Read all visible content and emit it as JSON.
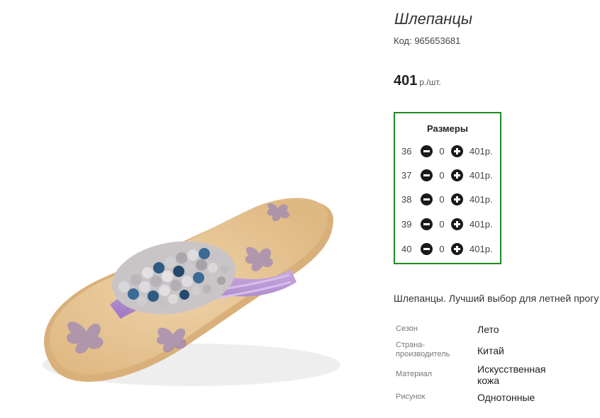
{
  "product": {
    "title": "Шлепанцы",
    "code": "Код: 965653681",
    "price": "401",
    "price_unit": "р./шт."
  },
  "sizes": {
    "heading": "Размеры",
    "rows": [
      {
        "size": "36",
        "qty": "0",
        "price": "401р."
      },
      {
        "size": "37",
        "qty": "0",
        "price": "401р."
      },
      {
        "size": "38",
        "qty": "0",
        "price": "401р."
      },
      {
        "size": "39",
        "qty": "0",
        "price": "401р."
      },
      {
        "size": "40",
        "qty": "0",
        "price": "401р."
      }
    ]
  },
  "description": "Шлепанцы. Лучший выбор для летней прогу",
  "properties": [
    {
      "label": "Сезон",
      "value": "Лето"
    },
    {
      "label": "Страна-производитель",
      "value": "Китай"
    },
    {
      "label": "Материал",
      "value": "Искусственная кожа"
    },
    {
      "label": "Рисунок",
      "value": "Однотонные"
    }
  ],
  "colors": {
    "border_accent": "#1e8a1e",
    "button": "#1a1a1a",
    "sole": "#e8c592",
    "strap": "#b48fd0",
    "print": "#9b84b8"
  },
  "icons": [
    "minus-icon",
    "plus-icon"
  ]
}
